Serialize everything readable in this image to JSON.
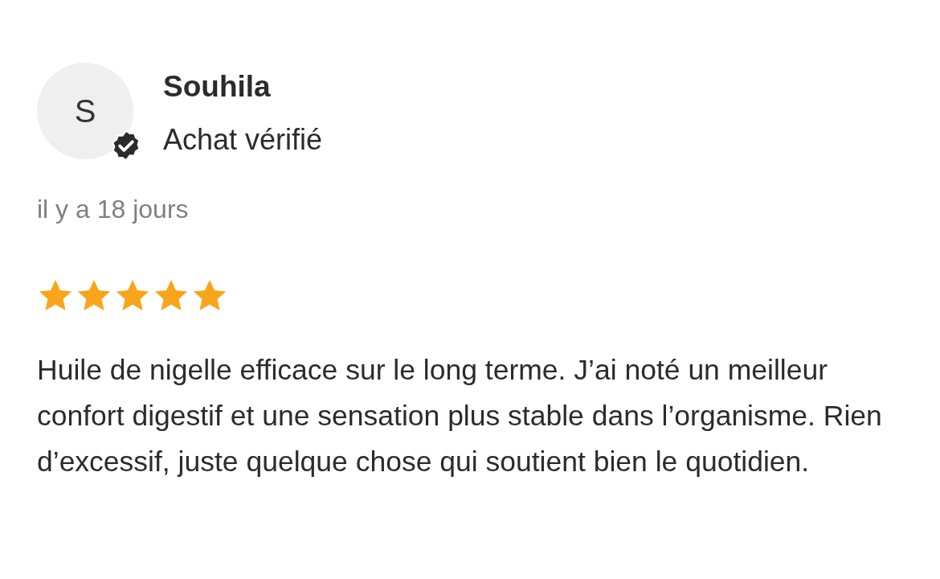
{
  "review": {
    "avatar_letter": "S",
    "verified": true,
    "author": "Souhila",
    "badge_text": "Achat vérifié",
    "date": "il y a 18 jours",
    "stars": 5,
    "text": "Huile de nigelle efficace sur le long terme. J’ai noté un meilleur confort digestif et une sensation plus stable dans l’organisme. Rien d’excessif, juste quelque chose qui soutient bien le quotidien."
  }
}
